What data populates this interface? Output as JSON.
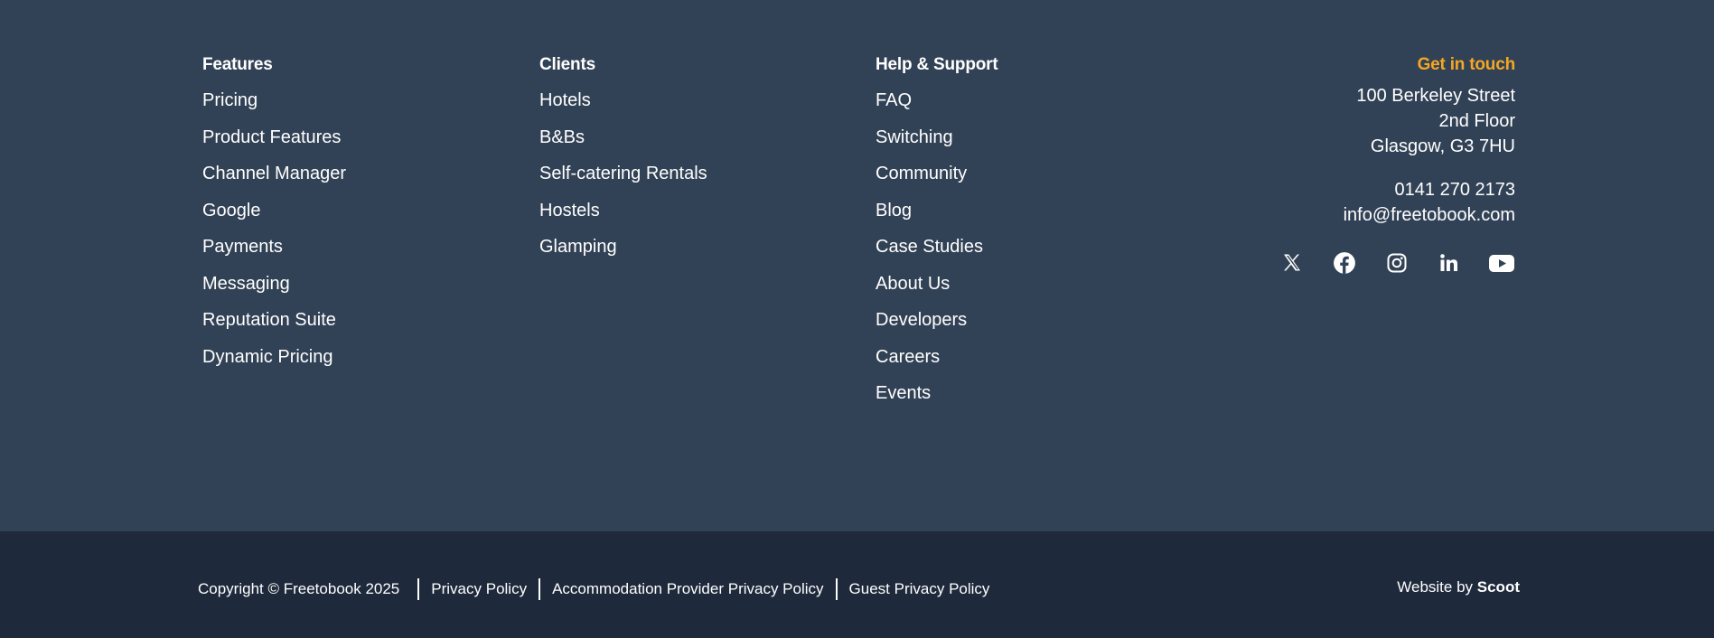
{
  "footer": {
    "features": {
      "heading": "Features",
      "links": [
        "Pricing",
        "Product Features",
        "Channel Manager",
        "Google",
        "Payments",
        "Messaging",
        "Reputation Suite",
        "Dynamic Pricing"
      ]
    },
    "clients": {
      "heading": "Clients",
      "links": [
        "Hotels",
        "B&Bs",
        "Self-catering Rentals",
        "Hostels",
        "Glamping"
      ]
    },
    "help": {
      "heading": "Help & Support",
      "links": [
        "FAQ",
        "Switching",
        "Community",
        "Blog",
        "Case Studies",
        "About Us",
        "Developers",
        "Careers",
        "Events"
      ]
    },
    "contact": {
      "heading": "Get in touch",
      "address": [
        "100 Berkeley Street",
        "2nd Floor",
        "Glasgow, G3 7HU"
      ],
      "phone": "0141 270 2173",
      "email": "info@freetobook.com",
      "heading_color": "#f5a623",
      "social": [
        "x-icon",
        "facebook-icon",
        "instagram-icon",
        "linkedin-icon",
        "youtube-icon"
      ]
    },
    "bottom": {
      "copyright": "Copyright © Freetobook 2025",
      "links": [
        "Privacy Policy",
        "Accommodation Provider Privacy Policy",
        "Guest Privacy Policy"
      ],
      "credit_prefix": "Website by",
      "credit_name": "Scoot"
    },
    "colors": {
      "main_bg": "#324256",
      "bottom_bg": "#1e293b",
      "text": "#ffffff",
      "accent": "#f5a623"
    }
  }
}
